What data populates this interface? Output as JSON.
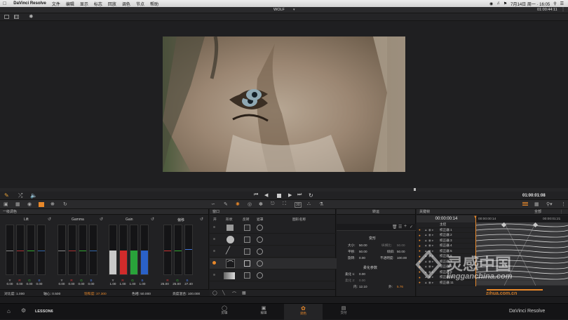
{
  "menubar": {
    "app": "DaVinci Resolve",
    "items": [
      "文件",
      "编辑",
      "显示",
      "标志",
      "回放",
      "调色",
      "节点",
      "帮助"
    ],
    "clock": "7月14日 周一 · 16:05"
  },
  "titlebar": {
    "project": "WOLF",
    "timecode": "01:00:44:11"
  },
  "transport": {
    "timecode": "01:00:01:08"
  },
  "colorwheels": {
    "title": "一级调色",
    "wheels": [
      {
        "name": "Lift",
        "letters": [
          "Y",
          "R",
          "G",
          "B"
        ],
        "values": [
          "0.00",
          "0.00",
          "0.00",
          "0.00"
        ]
      },
      {
        "name": "Gamma",
        "letters": [
          "Y",
          "R",
          "G",
          "B"
        ],
        "values": [
          "0.00",
          "0.00",
          "0.00",
          "0.00"
        ]
      },
      {
        "name": "Gain",
        "letters": [
          "Y",
          "R",
          "G",
          "B"
        ],
        "values": [
          "1.00",
          "1.00",
          "1.00",
          "1.00"
        ]
      },
      {
        "name": "偏移",
        "letters": [
          "R",
          "G",
          "B"
        ],
        "values": [
          "25.00",
          "25.00",
          "27.40"
        ]
      }
    ],
    "footer": {
      "contrast": "对比度: 1.000",
      "pivot": "轴心: 0.500",
      "sat": "饱和度: 37.300",
      "hue": "色相: 50.000",
      "lum_mix": "亮度混合: 100.000"
    }
  },
  "window": {
    "title": "窗口",
    "headers": [
      "开",
      "形状",
      "反转",
      "遮罩",
      "图形名称"
    ]
  },
  "tracker": {
    "title": "转运",
    "section1": "变形",
    "size_label": "大小:",
    "size_val": "50.00",
    "aspect_label": "纵横比:",
    "aspect_val": "50.00",
    "pan_label": "平移:",
    "pan_val": "50.00",
    "tilt_label": "倾斜:",
    "tilt_val": "50.00",
    "rotate_label": "旋转:",
    "rotate_val": "0.00",
    "opacity_label": "不透明度:",
    "opacity_val": "100.00",
    "section2": "柔化参数",
    "soft1_label": "柔化 1:",
    "soft1_val": "0.00",
    "soft2_label": "柔化 2:",
    "soft2_val": "0.00",
    "in_label": "内:",
    "in_val": "12.10",
    "out_label": "外:",
    "out_val": "5.76"
  },
  "keyframes": {
    "title": "关键帧",
    "mode": "全部",
    "tc_current": "00:00:00:14",
    "tc_start": "00:00:00:14",
    "tc_end": "00:00:01:21",
    "master": "主控",
    "rows": [
      "校正器 1",
      "校正器 2",
      "校正器 3",
      "校正器 4",
      "校正器 5",
      "校正器 6",
      "校正器 7",
      "校正器 8",
      "校正器 9",
      "校正器 10",
      "校正器 11"
    ]
  },
  "status": {
    "lesson": "LESSON6"
  },
  "pages": {
    "items": [
      "剪辑",
      "编辑",
      "调色",
      "交付"
    ],
    "active": 2,
    "brand": "DaVinci Resolve"
  },
  "watermark": {
    "line1": "灵感中国",
    "line2": "lingganchina.com",
    "line3": "zihua.com.cn"
  },
  "colors": {
    "accent": "#e8882a",
    "red": "#d12b2b",
    "green": "#29a33a",
    "blue": "#2a61c7"
  }
}
